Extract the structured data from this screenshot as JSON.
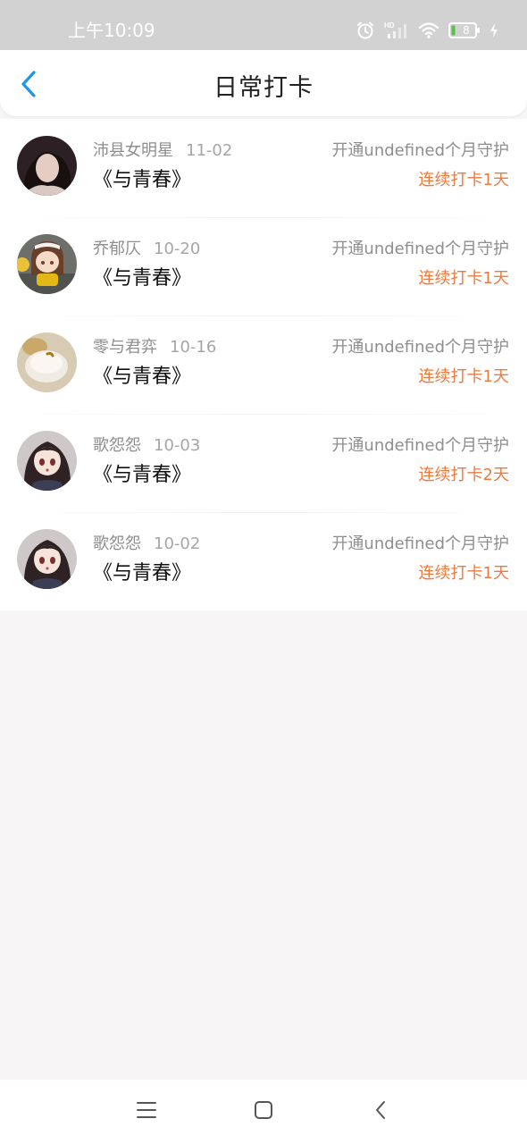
{
  "status_bar": {
    "time": "上午10:09",
    "battery_level": "8"
  },
  "header": {
    "title": "日常打卡",
    "back_icon": "chevron-left-icon"
  },
  "list": [
    {
      "user": "沛县女明星",
      "date": "11-02",
      "book": "《与青春》",
      "guard_text": "开通undefined个月守护",
      "streak_text": "连续打卡1天"
    },
    {
      "user": "乔郁仄",
      "date": "10-20",
      "book": "《与青春》",
      "guard_text": "开通undefined个月守护",
      "streak_text": "连续打卡1天"
    },
    {
      "user": "零与君弈",
      "date": "10-16",
      "book": "《与青春》",
      "guard_text": "开通undefined个月守护",
      "streak_text": "连续打卡1天"
    },
    {
      "user": "歌怨怨",
      "date": "10-03",
      "book": "《与青春》",
      "guard_text": "开通undefined个月守护",
      "streak_text": "连续打卡2天"
    },
    {
      "user": "歌怨怨",
      "date": "10-02",
      "book": "《与青春》",
      "guard_text": "开通undefined个月守护",
      "streak_text": "连续打卡1天"
    }
  ],
  "nav_bar": {
    "menu_icon": "menu-icon",
    "home_icon": "home-square-icon",
    "back_icon": "back-chevron-icon"
  },
  "colors": {
    "accent_blue": "#1f96e8",
    "streak_orange": "#ec7a3e",
    "status_bar_bg": "#d2d2d2",
    "page_bg": "#f7f5f6"
  }
}
